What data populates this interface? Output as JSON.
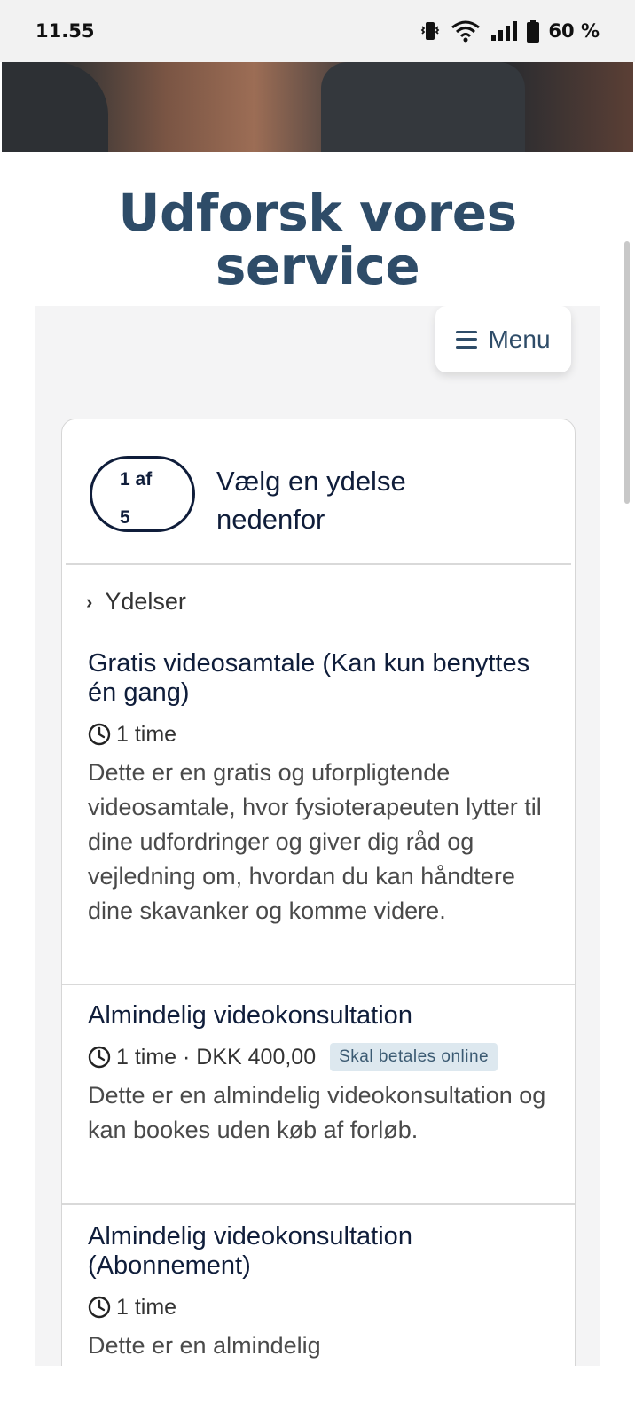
{
  "status_bar": {
    "time": "11.55",
    "battery": "60 %",
    "icons": [
      "vibrate-icon",
      "wifi-icon",
      "signal-icon",
      "battery-icon"
    ]
  },
  "page": {
    "heading_line1": "Udforsk vores",
    "heading_line2": "service"
  },
  "widget": {
    "menu_label": "Menu",
    "step": {
      "label_line1": "1 af",
      "label_line2": "5",
      "title": "Vælg en ydelse nedenfor"
    },
    "breadcrumb": "Ydelser",
    "services": [
      {
        "title": "Gratis videosamtale (Kan kun benyttes én gang)",
        "meta": "1 time",
        "description": "Dette er en gratis og uforpligtende videosamtale, hvor fysioterapeuten lytter til dine udfordringer og giver dig råd og vejledning om, hvordan du kan håndtere dine skavanker og komme videre."
      },
      {
        "title": "Almindelig videokonsultation",
        "meta": "1 time · DKK 400,00",
        "badge": "Skal betales online",
        "description": "Dette er en almindelig videokonsultation og kan bookes uden køb af forløb."
      },
      {
        "title": "Almindelig videokonsultation (Abonnement)",
        "meta": "1 time",
        "description": "Dette er en almindelig"
      }
    ]
  },
  "colors": {
    "heading": "#2e4c68",
    "text_dark": "#0f1d3a",
    "badge_bg": "#dde8ef",
    "panel_bg": "#f4f4f5"
  }
}
